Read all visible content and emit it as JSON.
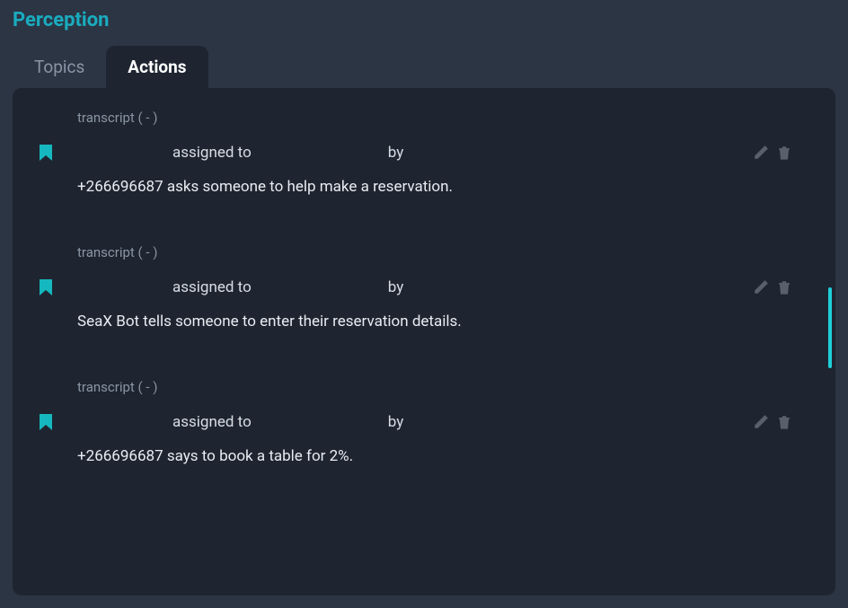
{
  "header": {
    "title": "Perception"
  },
  "tabs": {
    "topics": "Topics",
    "actions": "Actions"
  },
  "content": {
    "assigned_label": "assigned to",
    "by_label": "by",
    "items": [
      {
        "header": "transcript ( - )",
        "description": "+266696687 asks someone to help make a reservation."
      },
      {
        "header": "transcript ( - )",
        "description": "SeaX Bot tells someone to enter their reservation details."
      },
      {
        "header": "transcript ( - )",
        "description": "+266696687 says to book a table for 2%."
      }
    ]
  }
}
